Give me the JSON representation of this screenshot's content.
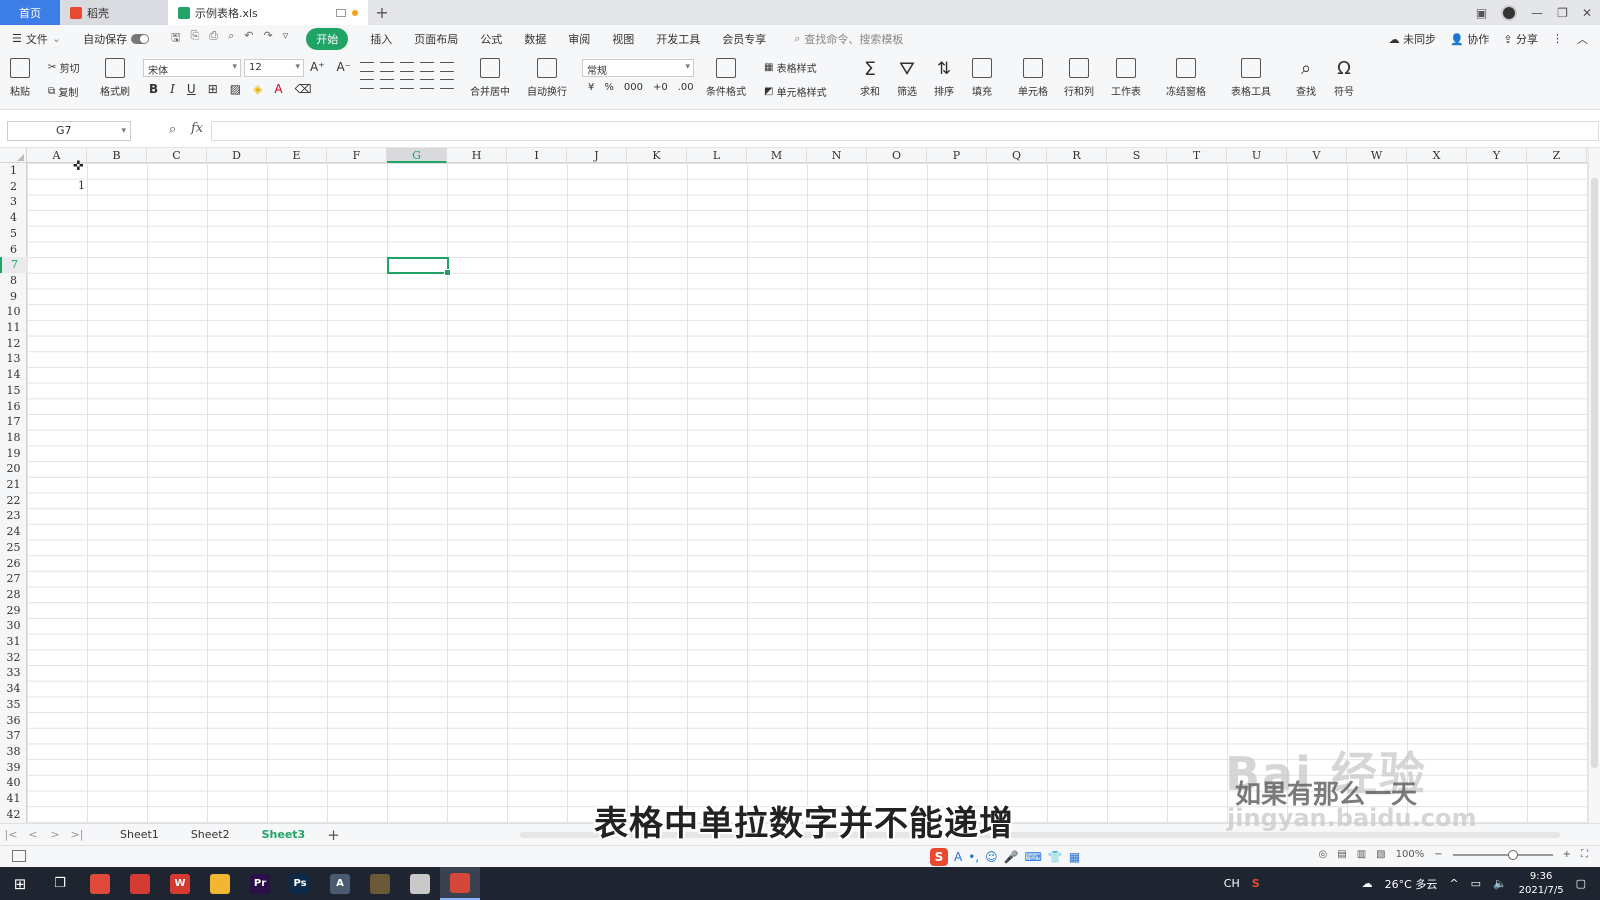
{
  "tabs": {
    "home": "首页",
    "shell": "稻壳",
    "doc": "示例表格.xls",
    "new_tab": "+"
  },
  "menu": {
    "file": "文件",
    "autosave": "自动保存",
    "items": [
      "开始",
      "插入",
      "页面布局",
      "公式",
      "数据",
      "审阅",
      "视图",
      "开发工具",
      "会员专享"
    ],
    "search_placeholder": "查找命令、搜索模板",
    "sync": "未同步",
    "collab": "协作",
    "share": "分享"
  },
  "ribbon": {
    "paste": "粘贴",
    "cut": "剪切",
    "copy": "复制",
    "format_painter": "格式刷",
    "font_name": "宋体",
    "font_size": "12",
    "bold": "B",
    "italic": "I",
    "underline": "U",
    "merge_center": "合并居中",
    "wrap_text": "自动换行",
    "number_format": "常规",
    "currency": "¥",
    "percent": "%",
    "thousands": "000",
    "inc_decimal": "+0",
    "dec_decimal": ".00",
    "conditional_format": "条件格式",
    "table_style": "表格样式",
    "cell_style": "单元格样式",
    "sum": "求和",
    "filter": "筛选",
    "sort": "排序",
    "fill": "填充",
    "cell": "单元格",
    "rows_cols": "行和列",
    "worksheet": "工作表",
    "freeze": "冻结窗格",
    "table_tools": "表格工具",
    "find": "查找",
    "symbol": "符号"
  },
  "formula": {
    "name_box": "G7",
    "fx": "fx",
    "value": ""
  },
  "columns": [
    "A",
    "B",
    "C",
    "D",
    "E",
    "F",
    "G",
    "H",
    "I",
    "J",
    "K",
    "L",
    "M",
    "N",
    "O",
    "P",
    "Q",
    "R",
    "S",
    "T",
    "U",
    "V",
    "W",
    "X",
    "Y",
    "Z"
  ],
  "selected_column": "G",
  "selected_row": "7",
  "rows": [
    "1",
    "2",
    "3",
    "4",
    "5",
    "6",
    "7",
    "8",
    "9",
    "10",
    "11",
    "12",
    "13",
    "14",
    "15",
    "16",
    "17",
    "18",
    "19",
    "20",
    "21",
    "22",
    "23",
    "24",
    "25",
    "26",
    "27",
    "28",
    "29",
    "30",
    "31",
    "32",
    "33",
    "34",
    "35",
    "36",
    "37",
    "38",
    "39",
    "40",
    "41",
    "42"
  ],
  "cells": {
    "A2": "1"
  },
  "sheets": {
    "items": [
      "Sheet1",
      "Sheet2",
      "Sheet3"
    ],
    "active": "Sheet3",
    "add": "+"
  },
  "status": {
    "zoom": "100%",
    "zoom_plus": "+"
  },
  "ime": {
    "logo": "S",
    "mode": "A"
  },
  "taskbar": {
    "apps": [
      {
        "name": "chrome-icon",
        "glyph": "",
        "color": "#e04a3a"
      },
      {
        "name": "netease-music-icon",
        "glyph": "",
        "color": "#d43c33"
      },
      {
        "name": "wps-icon",
        "glyph": "W",
        "color": "#d63a2f"
      },
      {
        "name": "file-explorer-icon",
        "glyph": "",
        "color": "#f2b632"
      },
      {
        "name": "premiere-icon",
        "glyph": "Pr",
        "color": "#2a0f4a"
      },
      {
        "name": "photoshop-icon",
        "glyph": "Ps",
        "color": "#0b2a4a"
      },
      {
        "name": "app-a-icon",
        "glyph": "A",
        "color": "#4a5a70"
      },
      {
        "name": "video-editor-icon",
        "glyph": "",
        "color": "#6b5a3a"
      },
      {
        "name": "slides-icon",
        "glyph": "",
        "color": "#c9c9c9"
      },
      {
        "name": "spreadsheet-icon",
        "glyph": "",
        "color": "#d2473a"
      }
    ],
    "lang": "CH",
    "weather": "26°C 多云",
    "time": "9:36",
    "date": "2021/7/5"
  },
  "overlay": {
    "subtitle": "表格中单拉数字并不能递增",
    "watermark_brand": "Bai 经验",
    "watermark_url": "jingyan.baidu.com",
    "watermark_caption": "如果有那么一天"
  },
  "colors": {
    "accent": "#21a366",
    "home_tab": "#3d7ee6",
    "taskbar": "#1f2530"
  }
}
